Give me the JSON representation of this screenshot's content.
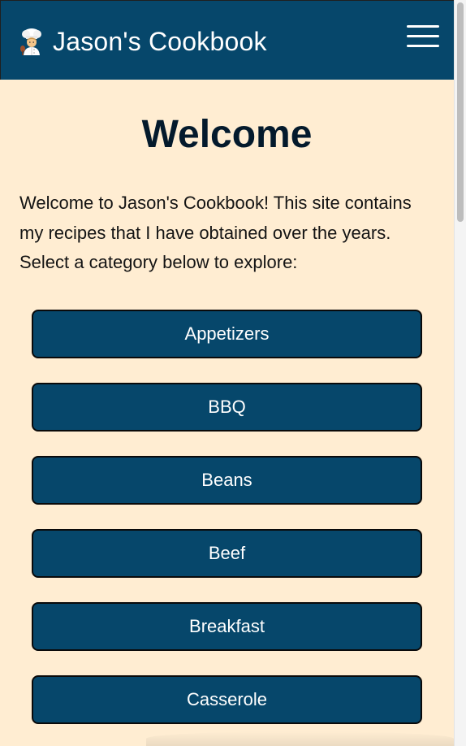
{
  "header": {
    "title": "Jason's Cookbook",
    "logo_icon": "chef-emoji-icon",
    "menu_icon": "hamburger-menu-icon",
    "background_color": "#06476b"
  },
  "main": {
    "heading": "Welcome",
    "intro": "Welcome to Jason's Cookbook! This site contains my recipes that I have obtained over the years. Select a category below to explore:",
    "background_color": "#ffedd2",
    "categories": [
      {
        "label": "Appetizers"
      },
      {
        "label": "BBQ"
      },
      {
        "label": "Beans"
      },
      {
        "label": "Beef"
      },
      {
        "label": "Breakfast"
      },
      {
        "label": "Casserole"
      }
    ],
    "button_color": "#06476b"
  }
}
